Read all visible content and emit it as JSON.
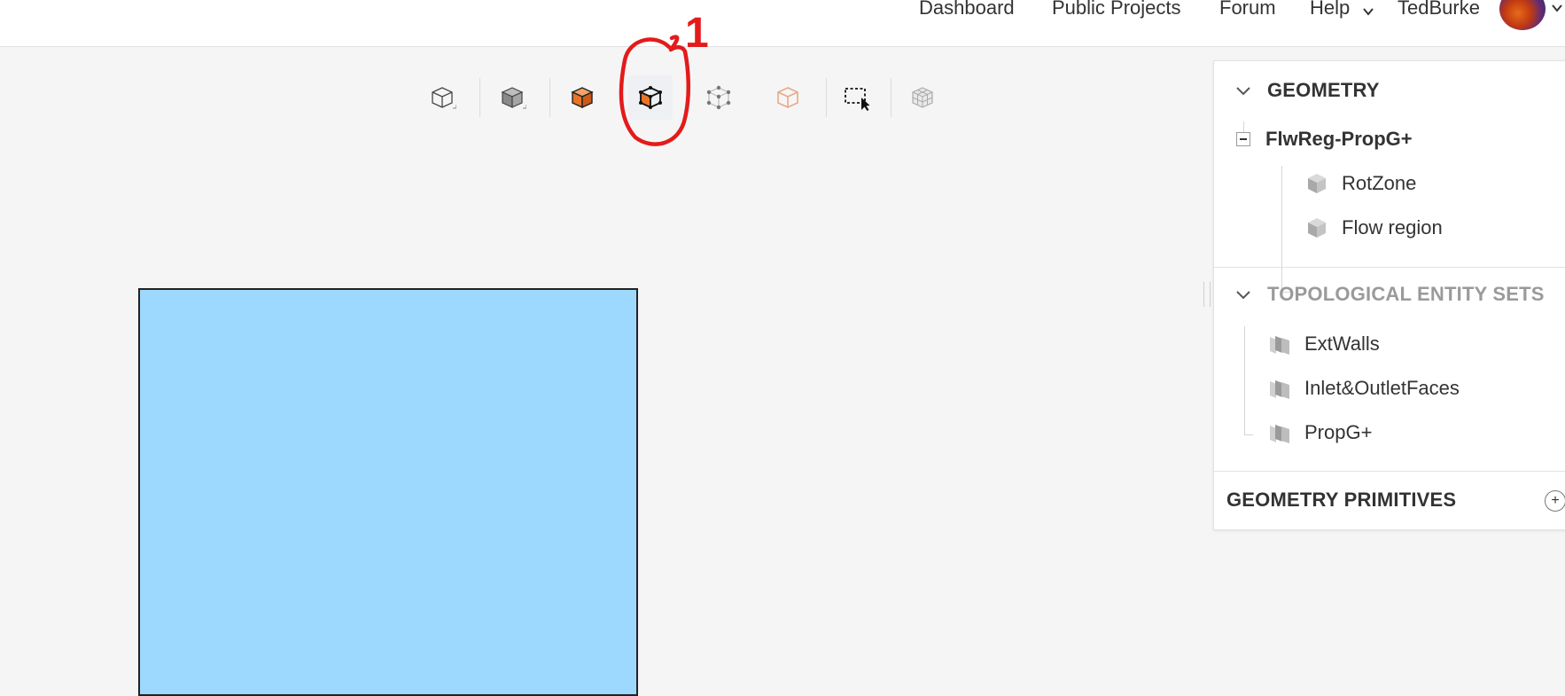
{
  "header": {
    "nav": [
      {
        "label": "Dashboard"
      },
      {
        "label": "Public Projects"
      },
      {
        "label": "Forum"
      },
      {
        "label": "Help"
      }
    ],
    "username": "TedBurke"
  },
  "toolbar": {
    "buttons": [
      {
        "icon": "cube-wireframe-select-icon"
      },
      {
        "icon": "cube-solid-select-icon"
      },
      {
        "icon": "face-select-icon"
      },
      {
        "icon": "edge-select-icon",
        "selected": true
      },
      {
        "icon": "vertex-select-icon"
      },
      {
        "icon": "volume-select-icon"
      },
      {
        "icon": "box-select-icon"
      },
      {
        "icon": "mesh-select-icon"
      }
    ]
  },
  "annotation": {
    "label": "1",
    "color": "#e31b1b"
  },
  "panel": {
    "geometry": {
      "title": "GEOMETRY",
      "root": {
        "label": "FlwReg-PropG+"
      },
      "children": [
        {
          "label": "RotZone"
        },
        {
          "label": "Flow region"
        }
      ]
    },
    "topological": {
      "title": "TOPOLOGICAL ENTITY SETS",
      "items": [
        {
          "label": "ExtWalls"
        },
        {
          "label": "Inlet&OutletFaces"
        },
        {
          "label": "PropG+"
        }
      ]
    },
    "primitives": {
      "title": "GEOMETRY PRIMITIVES",
      "add_label": "+"
    }
  },
  "colors": {
    "accent_orange": "#e8742a",
    "shape_fill": "#9dd9fe",
    "annotation_red": "#e31b1b"
  }
}
